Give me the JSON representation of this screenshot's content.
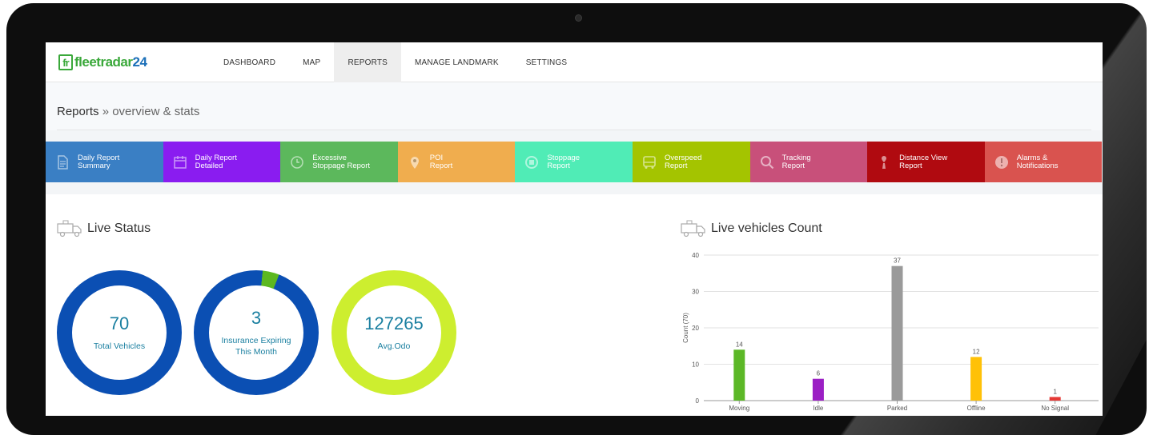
{
  "nav": {
    "logo_prefix": "fr",
    "logo_main": "fleetradar",
    "logo_accent": "24",
    "items": [
      {
        "label": "DASHBOARD",
        "active": false
      },
      {
        "label": "MAP",
        "active": false
      },
      {
        "label": "REPORTS",
        "active": true
      },
      {
        "label": "MANAGE LANDMARK",
        "active": false
      },
      {
        "label": "SETTINGS",
        "active": false
      }
    ]
  },
  "page": {
    "title": "Reports",
    "separator": " » ",
    "subtitle": "overview & stats"
  },
  "tiles": [
    {
      "label": "Daily Report\nSummary",
      "color": "#3a7fc4",
      "icon": "document-icon"
    },
    {
      "label": "Daily Report\nDetailed",
      "color": "#8a1cf0",
      "icon": "calendar-icon"
    },
    {
      "label": "Excessive\nStoppage Report",
      "color": "#5cb85c",
      "icon": "clock-icon"
    },
    {
      "label": "POI\nReport",
      "color": "#f0ad4e",
      "icon": "map-pin-icon"
    },
    {
      "label": "Stoppage\nReport",
      "color": "#50ecb6",
      "icon": "stop-circle-icon"
    },
    {
      "label": "Overspeed\nReport",
      "color": "#a4c400",
      "icon": "bus-icon"
    },
    {
      "label": "Tracking\nReport",
      "color": "#c8507a",
      "icon": "search-icon"
    },
    {
      "label": "Distance View\nReport",
      "color": "#b00a10",
      "icon": "road-pin-icon"
    },
    {
      "label": "Alarms &\nNotifications",
      "color": "#d9534f",
      "icon": "alert-icon"
    }
  ],
  "live_status": {
    "title": "Live Status",
    "rings": [
      {
        "value": "70",
        "label": "Total Vehicles",
        "color": "#0b4fb3",
        "accent": "#0b4fb3",
        "accent_fraction": 0
      },
      {
        "value": "3",
        "label": "Insurance Expiring\nThis Month",
        "color": "#0b4fb3",
        "accent": "#5cb820",
        "accent_fraction": 0.043
      },
      {
        "value": "127265",
        "label": "Avg.Odo",
        "color": "#cdee2f",
        "accent": "#cdee2f",
        "accent_fraction": 0
      }
    ]
  },
  "live_count": {
    "title": "Live vehicles Count"
  },
  "chart_data": {
    "type": "bar",
    "categories": [
      "Moving",
      "Idle",
      "Parked",
      "Offline",
      "No Signal"
    ],
    "values": [
      14,
      6,
      37,
      12,
      1
    ],
    "colors": [
      "#5cb827",
      "#9b1fc4",
      "#9a9a9a",
      "#ffc107",
      "#e53935"
    ],
    "ylabel": "Count (70)",
    "ylim": [
      0,
      40
    ],
    "yticks": [
      0,
      10,
      20,
      30,
      40
    ],
    "grid": true
  }
}
